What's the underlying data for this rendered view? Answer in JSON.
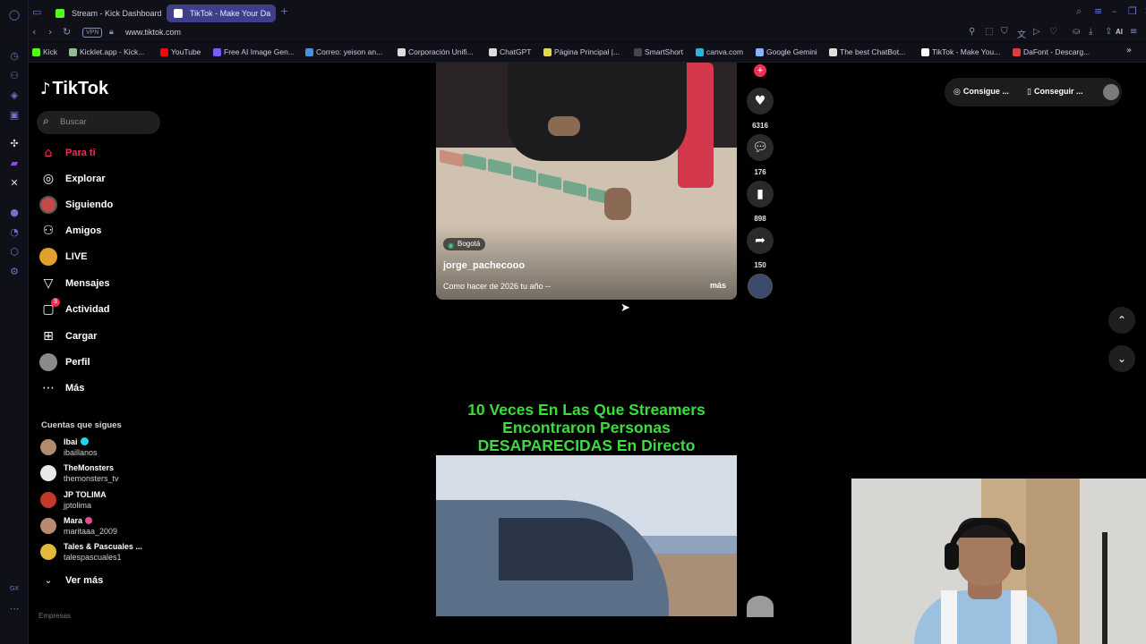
{
  "browser": {
    "tabs": [
      {
        "label": "Stream - Kick Dashboard",
        "color": "#53fc18"
      },
      {
        "label": "TikTok - Make Your Da",
        "color": "#ffffff"
      }
    ],
    "vpn_label": "VPN",
    "url": "www.tiktok.com",
    "ai_label": "AI",
    "bookmarks": [
      {
        "label": "Kick",
        "color": "#53fc18"
      },
      {
        "label": "Kicklet.app - Kick...",
        "color": "#8fbf8f"
      },
      {
        "label": "YouTube",
        "color": "#ff0000"
      },
      {
        "label": "Free AI Image Gen...",
        "color": "#7c5cff"
      },
      {
        "label": "Correo: yeison an...",
        "color": "#4a90e2"
      },
      {
        "label": "Corporación Unifi...",
        "color": "#dddddd"
      },
      {
        "label": "ChatGPT",
        "color": "#dddddd"
      },
      {
        "label": "Página Principal |...",
        "color": "#e6d84a"
      },
      {
        "label": "SmartShort",
        "color": "#444455"
      },
      {
        "label": "canva.com",
        "color": "#27b5d6"
      },
      {
        "label": "Google Gemini",
        "color": "#8ab4f8"
      },
      {
        "label": "The best ChatBot...",
        "color": "#dddddd"
      },
      {
        "label": "TikTok - Make You...",
        "color": "#ffffff"
      },
      {
        "label": "DaFont - Descarg...",
        "color": "#e23b3b"
      }
    ]
  },
  "tiktok": {
    "logo": "TikTok",
    "search_placeholder": "Buscar",
    "menu": [
      {
        "label": "Para ti",
        "icon": "home-icon"
      },
      {
        "label": "Explorar",
        "icon": "compass-icon"
      },
      {
        "label": "Siguiendo",
        "icon": "following-avatar-icon"
      },
      {
        "label": "Amigos",
        "icon": "friends-icon"
      },
      {
        "label": "LIVE",
        "icon": "live-avatar-icon"
      },
      {
        "label": "Mensajes",
        "icon": "paper-plane-icon"
      },
      {
        "label": "Actividad",
        "icon": "activity-icon",
        "badge": "3"
      },
      {
        "label": "Cargar",
        "icon": "upload-plus-icon"
      },
      {
        "label": "Perfil",
        "icon": "profile-avatar-icon"
      },
      {
        "label": "Más",
        "icon": "more-dots-icon"
      }
    ],
    "following_title": "Cuentas que sigues",
    "following": [
      {
        "name": "Ibai",
        "handle": "ibaillanos",
        "mark": "verified",
        "color": "#b08b6e"
      },
      {
        "name": "TheMonsters",
        "handle": "themonsters_tv",
        "mark": "",
        "color": "#e8e8e8"
      },
      {
        "name": "JP TOLIMA",
        "handle": "jptolima",
        "mark": "",
        "color": "#c0392b"
      },
      {
        "name": "Mara",
        "handle": "maritaaa_2009",
        "mark": "heart",
        "color": "#b58a70"
      },
      {
        "name": "Tales & Pascuales ...",
        "handle": "talespascuales1",
        "mark": "",
        "color": "#e2b93b"
      }
    ],
    "ver_mas": "Ver más",
    "footer_cut": "Empresas"
  },
  "video1": {
    "location": "Bogotá",
    "username": "jorge_pachecooo",
    "caption": "Como hacer de 2026 tu año --",
    "more": "más",
    "likes": "6316",
    "comments": "176",
    "saves": "898",
    "shares": "150"
  },
  "video2": {
    "title_lines": [
      "10 Veces En Las Que Streamers",
      "Encontraron Personas",
      "DESAPARECIDAS En Directo"
    ]
  },
  "topbar": {
    "coins_label": "Consigue ...",
    "app_label": "Conseguir ..."
  }
}
